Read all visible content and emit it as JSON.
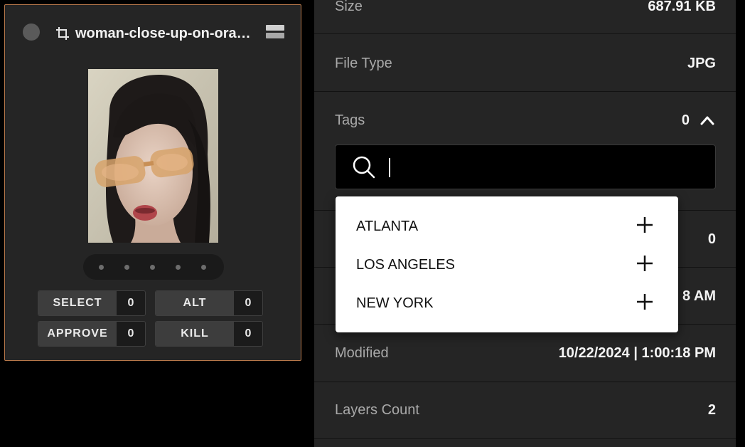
{
  "asset_card": {
    "title": "woman-close-up-on-orange-sunglasses.jpg",
    "counters": [
      {
        "label": "SELECT",
        "value": "0"
      },
      {
        "label": "ALT",
        "value": "0"
      },
      {
        "label": "APPROVE",
        "value": "0"
      },
      {
        "label": "KILL",
        "value": "0"
      }
    ],
    "icons": [
      "radio-circle",
      "crop-icon",
      "stack-icon"
    ],
    "accent_border": "#b8784a"
  },
  "details": {
    "size": {
      "label": "Size",
      "value": "687.91 KB"
    },
    "file_type": {
      "label": "File Type",
      "value": "JPG"
    },
    "tags": {
      "label": "Tags",
      "count": "0"
    },
    "hidden_row_value": "0",
    "created_partial": "8 AM",
    "modified": {
      "label": "Modified",
      "value": "10/22/2024 | 1:00:18 PM"
    },
    "layers_count": {
      "label": "Layers Count",
      "value": "2"
    }
  },
  "tag_search": {
    "value": "",
    "placeholder": ""
  },
  "tag_suggestions": [
    {
      "label": "ATLANTA"
    },
    {
      "label": "LOS ANGELES"
    },
    {
      "label": "NEW YORK"
    }
  ]
}
